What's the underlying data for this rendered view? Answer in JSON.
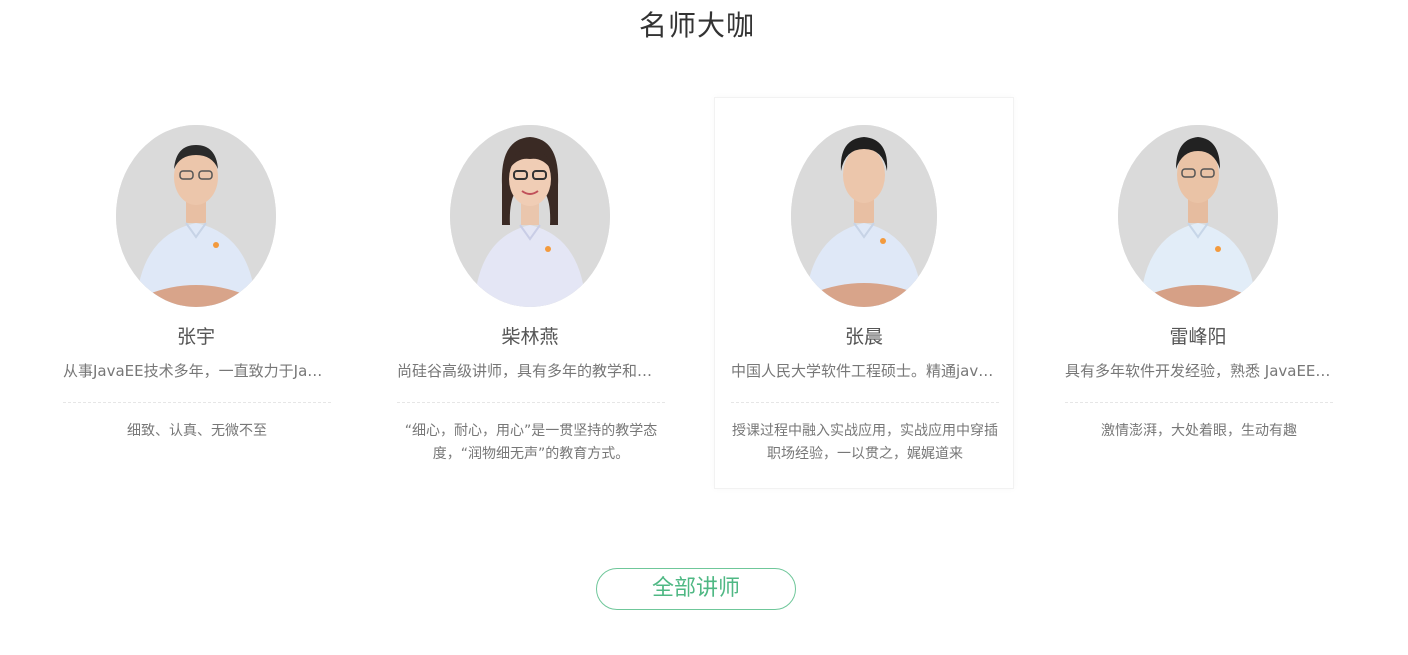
{
  "section": {
    "title": "名师大咖"
  },
  "teachers": [
    {
      "name": "张宇",
      "intro": "从事JavaEE技术多年，一直致力于Java开发与教学",
      "quote": "细致、认真、无微不至"
    },
    {
      "name": "柴林燕",
      "intro": "尚硅谷高级讲师，具有多年的教学和项目开发经验",
      "quote": "“细心，耐心，用心”是一贯坚持的教学态度，“润物细无声”的教育方式。"
    },
    {
      "name": "张晨",
      "intro": "中国人民大学软件工程硕士。精通java开发",
      "quote": "授课过程中融入实战应用，实战应用中穿插职场经验，一以贯之，娓娓道来"
    },
    {
      "name": "雷峰阳",
      "intro": "具有多年软件开发经验，熟悉 JavaEE 开发",
      "quote": "激情澎湃，大处着眼，生动有趣"
    }
  ],
  "actions": {
    "all_teachers_label": "全部讲师"
  },
  "colors": {
    "accent": "#4fb884",
    "avatar_bg": "#dadada",
    "shirt": "#dfe8f7"
  }
}
